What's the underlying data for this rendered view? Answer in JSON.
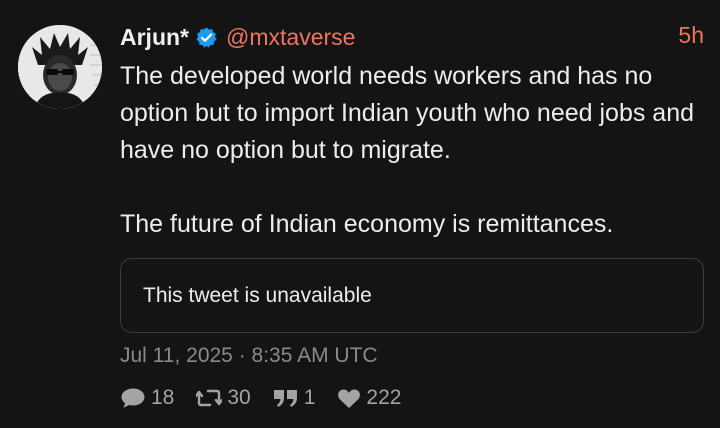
{
  "author": {
    "display_name": "Arjun*",
    "handle": "@mxtaverse",
    "verified": true,
    "avatar_icon": "profile-photo"
  },
  "relative_time": "5h",
  "body_paragraphs": [
    "The developed world needs workers and has no option but to import Indian youth who need jobs and have no option but to migrate.",
    "The future of Indian economy is remittances."
  ],
  "quoted_tweet": {
    "text": "This tweet is unavailable"
  },
  "timestamp": "Jul 11, 2025 · 8:35 AM UTC",
  "stats": {
    "replies": "18",
    "retweets": "30",
    "quotes": "1",
    "likes": "222"
  },
  "colors": {
    "background": "#141414",
    "accent": "#f0745f",
    "verified_badge": "#1d9bf0",
    "muted": "#8a8a8a"
  }
}
